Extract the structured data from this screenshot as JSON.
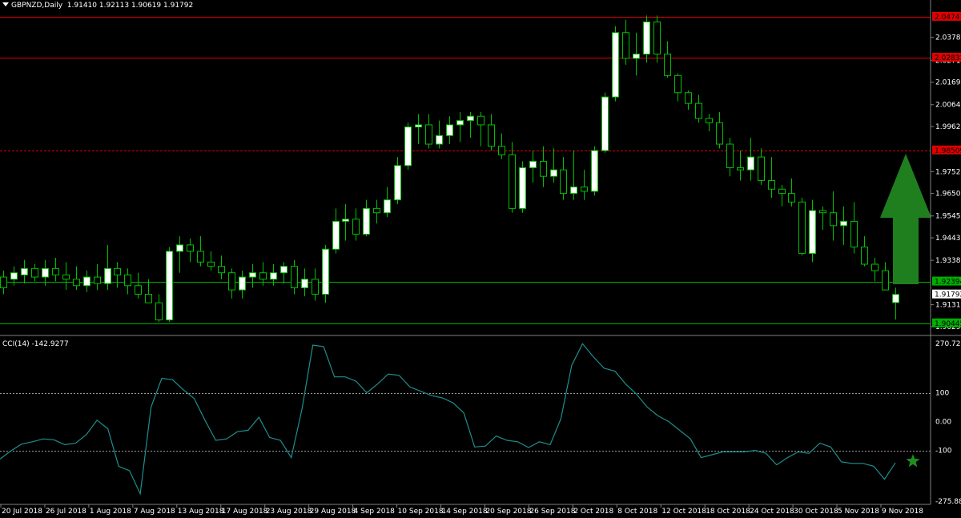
{
  "header": {
    "symbol_tf": "GBPNZD,Daily",
    "ohlc": "1.91410 1.92113 1.90619 1.91792"
  },
  "cci_header": {
    "label": "CCI(14) -142.9277"
  },
  "colors": {
    "background": "#000000",
    "bull_body": "#ffffff",
    "bear_body": "#000000",
    "wick": "#00c000",
    "resistance_line": "#e00000",
    "support_line": "#00b000",
    "cci_line": "#1e8f8f",
    "arrow": "#1f7f1f",
    "star": "#1f8f1f",
    "axis": "#808080"
  },
  "chart_data": [
    {
      "type": "candlestick",
      "title": "GBPNZD,Daily",
      "price_axis_ticks": [
        "2.03780",
        "2.02710",
        "2.01690",
        "2.00640",
        "1.99620",
        "1.97520",
        "1.96500",
        "1.95450",
        "1.94430",
        "1.93380",
        "1.91310",
        "1.90290"
      ],
      "highlighted_levels": [
        {
          "value": "2.04741",
          "style": "solid",
          "color": "#e00000"
        },
        {
          "value": "2.02833",
          "style": "solid",
          "color": "#e00000"
        },
        {
          "value": "1.98509",
          "style": "dashed",
          "color": "#e00000"
        },
        {
          "value": "1.92394",
          "style": "solid",
          "color": "#00b000"
        },
        {
          "value": "1.90445",
          "style": "solid",
          "color": "#00b000"
        }
      ],
      "current_price": "1.91792",
      "ylim": [
        1.9025,
        2.0485
      ],
      "candles": [
        [
          1.926,
          1.929,
          1.918,
          1.921
        ],
        [
          1.925,
          1.931,
          1.922,
          1.928
        ],
        [
          1.927,
          1.934,
          1.923,
          1.93
        ],
        [
          1.93,
          1.932,
          1.924,
          1.926
        ],
        [
          1.926,
          1.934,
          1.922,
          1.93
        ],
        [
          1.93,
          1.935,
          1.924,
          1.927
        ],
        [
          1.927,
          1.933,
          1.92,
          1.925
        ],
        [
          1.925,
          1.931,
          1.92,
          1.922
        ],
        [
          1.922,
          1.929,
          1.919,
          1.926
        ],
        [
          1.926,
          1.932,
          1.92,
          1.923
        ],
        [
          1.923,
          1.941,
          1.92,
          1.93
        ],
        [
          1.93,
          1.933,
          1.921,
          1.927
        ],
        [
          1.927,
          1.93,
          1.918,
          1.922
        ],
        [
          1.922,
          1.928,
          1.916,
          1.918
        ],
        [
          1.918,
          1.925,
          1.914,
          1.914
        ],
        [
          1.914,
          1.918,
          1.905,
          1.906
        ],
        [
          1.906,
          1.94,
          1.905,
          1.938
        ],
        [
          1.938,
          1.945,
          1.928,
          1.941
        ],
        [
          1.941,
          1.944,
          1.933,
          1.938
        ],
        [
          1.938,
          1.945,
          1.931,
          1.933
        ],
        [
          1.933,
          1.938,
          1.929,
          1.931
        ],
        [
          1.931,
          1.936,
          1.925,
          1.928
        ],
        [
          1.928,
          1.93,
          1.916,
          1.92
        ],
        [
          1.92,
          1.929,
          1.916,
          1.926
        ],
        [
          1.926,
          1.932,
          1.921,
          1.928
        ],
        [
          1.928,
          1.933,
          1.922,
          1.925
        ],
        [
          1.925,
          1.932,
          1.922,
          1.928
        ],
        [
          1.928,
          1.933,
          1.923,
          1.931
        ],
        [
          1.931,
          1.934,
          1.918,
          1.921
        ],
        [
          1.921,
          1.93,
          1.917,
          1.925
        ],
        [
          1.925,
          1.93,
          1.915,
          1.918
        ],
        [
          1.918,
          1.941,
          1.914,
          1.939
        ],
        [
          1.939,
          1.958,
          1.937,
          1.952
        ],
        [
          1.952,
          1.96,
          1.943,
          1.953
        ],
        [
          1.953,
          1.958,
          1.943,
          1.946
        ],
        [
          1.946,
          1.962,
          1.945,
          1.958
        ],
        [
          1.958,
          1.962,
          1.951,
          1.956
        ],
        [
          1.956,
          1.968,
          1.954,
          1.962
        ],
        [
          1.962,
          1.982,
          1.96,
          1.978
        ],
        [
          1.978,
          1.998,
          1.976,
          1.996
        ],
        [
          1.996,
          2.002,
          1.988,
          1.997
        ],
        [
          1.997,
          2.002,
          1.986,
          1.988
        ],
        [
          1.988,
          1.999,
          1.986,
          1.992
        ],
        [
          1.992,
          2.001,
          1.988,
          1.997
        ],
        [
          1.997,
          2.003,
          1.989,
          1.999
        ],
        [
          1.999,
          2.003,
          1.991,
          2.001
        ],
        [
          2.001,
          2.003,
          1.987,
          1.997
        ],
        [
          1.997,
          2.002,
          1.985,
          1.987
        ],
        [
          1.987,
          1.993,
          1.981,
          1.983
        ],
        [
          1.983,
          1.989,
          1.956,
          1.958
        ],
        [
          1.958,
          1.98,
          1.956,
          1.977
        ],
        [
          1.977,
          1.985,
          1.97,
          1.98
        ],
        [
          1.98,
          1.987,
          1.968,
          1.973
        ],
        [
          1.973,
          1.986,
          1.97,
          1.976
        ],
        [
          1.976,
          1.982,
          1.962,
          1.965
        ],
        [
          1.965,
          1.985,
          1.962,
          1.968
        ],
        [
          1.968,
          1.976,
          1.962,
          1.966
        ],
        [
          1.966,
          1.987,
          1.964,
          1.985
        ],
        [
          1.985,
          2.012,
          1.984,
          2.01
        ],
        [
          2.01,
          2.043,
          2.008,
          2.04
        ],
        [
          2.04,
          2.046,
          2.025,
          2.028
        ],
        [
          2.028,
          2.04,
          2.02,
          2.03
        ],
        [
          2.03,
          2.048,
          2.026,
          2.045
        ],
        [
          2.045,
          2.048,
          2.026,
          2.03
        ],
        [
          2.03,
          2.036,
          2.019,
          2.02
        ],
        [
          2.02,
          2.021,
          2.008,
          2.012
        ],
        [
          2.012,
          2.013,
          2.004,
          2.007
        ],
        [
          2.007,
          2.011,
          1.998,
          2.0
        ],
        [
          2.0,
          2.002,
          1.994,
          1.998
        ],
        [
          1.998,
          2.003,
          1.986,
          1.988
        ],
        [
          1.988,
          1.991,
          1.973,
          1.977
        ],
        [
          1.977,
          1.985,
          1.971,
          1.976
        ],
        [
          1.976,
          1.991,
          1.971,
          1.982
        ],
        [
          1.982,
          1.986,
          1.969,
          1.971
        ],
        [
          1.971,
          1.982,
          1.963,
          1.967
        ],
        [
          1.967,
          1.969,
          1.959,
          1.965
        ],
        [
          1.965,
          1.972,
          1.959,
          1.961
        ],
        [
          1.961,
          1.963,
          1.936,
          1.937
        ],
        [
          1.937,
          1.962,
          1.933,
          1.957
        ],
        [
          1.957,
          1.959,
          1.948,
          1.956
        ],
        [
          1.956,
          1.966,
          1.943,
          1.95
        ],
        [
          1.95,
          1.959,
          1.941,
          1.952
        ],
        [
          1.952,
          1.961,
          1.937,
          1.94
        ],
        [
          1.94,
          1.945,
          1.931,
          1.932
        ],
        [
          1.932,
          1.935,
          1.924,
          1.929
        ],
        [
          1.929,
          1.933,
          1.92,
          1.92
        ],
        [
          1.9141,
          1.9211,
          1.9062,
          1.9179
        ]
      ]
    },
    {
      "type": "line",
      "title": "CCI(14) -142.9277",
      "y_axis_ticks": [
        "270.7274",
        "100",
        "0.00",
        "-100",
        "-275.8897"
      ],
      "ylim": [
        -275.8897,
        270.7274
      ],
      "reference_levels": [
        100,
        -100
      ],
      "series": [
        {
          "values": [
            -130,
            -102,
            -78,
            -70,
            -60,
            -63,
            -80,
            -75,
            -45,
            5,
            -25,
            -155,
            -170,
            -250,
            50,
            150,
            145,
            110,
            80,
            5,
            -65,
            -60,
            -35,
            -30,
            15,
            -55,
            -65,
            -125,
            45,
            265,
            260,
            155,
            155,
            140,
            100,
            130,
            165,
            160,
            120,
            105,
            90,
            82,
            65,
            30,
            -88,
            -85,
            -50,
            -65,
            -70,
            -90,
            -70,
            -80,
            10,
            195,
            270,
            225,
            185,
            175,
            130,
            95,
            50,
            20,
            0,
            -30,
            -60,
            -125,
            -115,
            -105,
            -105,
            -105,
            -100,
            -110,
            -150,
            -125,
            -105,
            -110,
            -75,
            -88,
            -140,
            -145,
            -145,
            -155,
            -200,
            -143
          ]
        }
      ],
      "annotation": "star-marker at last value"
    }
  ],
  "x_axis": {
    "labels": [
      "20 Jul 2018",
      "26 Jul 2018",
      "1 Aug 2018",
      "7 Aug 2018",
      "13 Aug 2018",
      "17 Aug 2018",
      "23 Aug 2018",
      "29 Aug 2018",
      "4 Sep 2018",
      "10 Sep 2018",
      "14 Sep 2018",
      "20 Sep 2018",
      "26 Sep 2018",
      "2 Oct 2018",
      "8 Oct 2018",
      "12 Oct 2018",
      "18 Oct 2018",
      "24 Oct 2018",
      "30 Oct 2018",
      "5 Nov 2018",
      "9 Nov 2018"
    ]
  },
  "arrow": {
    "direction": "up",
    "icon": "up-arrow-icon"
  }
}
